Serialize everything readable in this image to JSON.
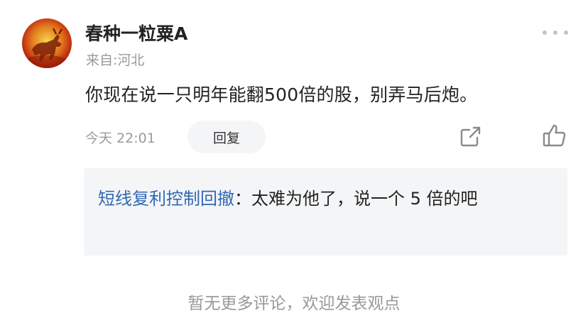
{
  "comment": {
    "avatar_icon": "ox-avatar-icon",
    "username": "春种一粒粟A",
    "location": "来自:河北",
    "text": "你现在说一只明年能翻500倍的股，别弄马后炮。",
    "time": "今天 22:01",
    "reply_label": "回复",
    "more_icon": "more-dots-icon",
    "share_icon": "share-icon",
    "like_icon": "thumbs-up-icon"
  },
  "reply": {
    "author": "短线复利控制回撤",
    "separator": "：",
    "text": "太难为他了，说一个 5 倍的吧"
  },
  "footer": {
    "no_more": "暂无更多评论，欢迎发表观点"
  },
  "colors": {
    "reply_author": "#2f68b6",
    "muted_text": "#9a9a9a",
    "reply_bg": "#f4f5f7"
  }
}
